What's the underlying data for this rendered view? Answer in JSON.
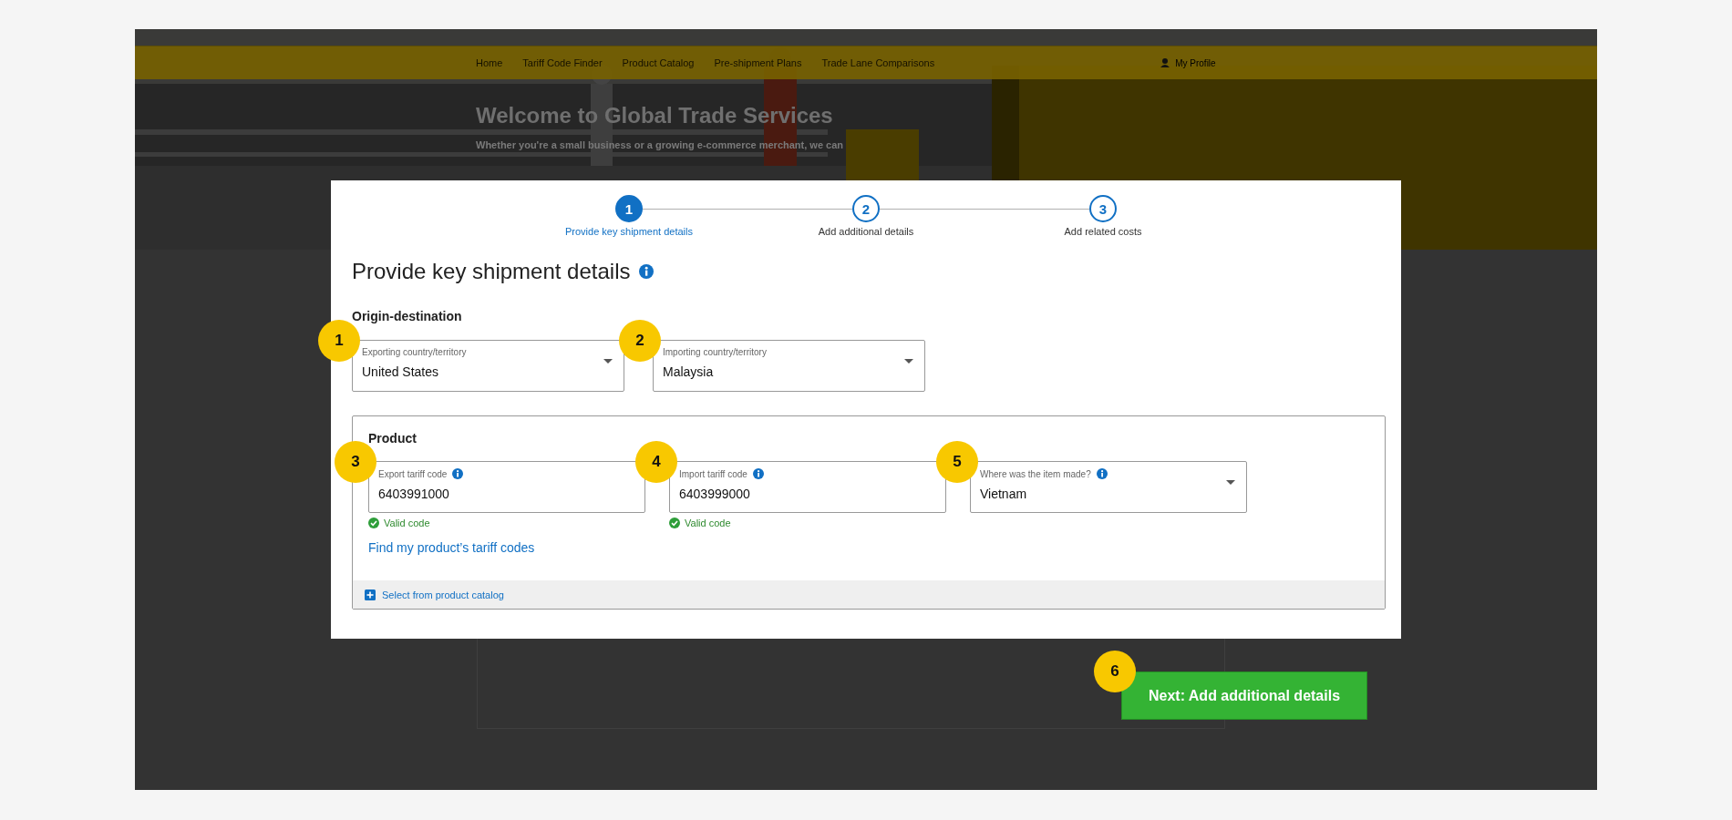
{
  "nav": {
    "items": [
      {
        "label": "Home"
      },
      {
        "label": "Tariff Code Finder"
      },
      {
        "label": "Product Catalog"
      },
      {
        "label": "Pre-shipment Plans"
      },
      {
        "label": "Trade Lane Comparisons"
      }
    ],
    "profile": "My Profile"
  },
  "hero": {
    "title": "Welcome to Global Trade Services",
    "subtitle": "Whether you're a small business or a growing e-commerce merchant, we can"
  },
  "dialog": {
    "steps": [
      {
        "number": "1",
        "label": "Provide key shipment details",
        "selected": true
      },
      {
        "number": "2",
        "label": "Add additional details",
        "selected": false
      },
      {
        "number": "3",
        "label": "Add related costs",
        "selected": false
      }
    ],
    "title": "Provide key shipment details",
    "origin": {
      "heading": "Origin-destination",
      "fields": [
        {
          "kind": "dropdown",
          "label": "Exporting country/territory",
          "value": "United States",
          "badge": "1"
        },
        {
          "kind": "dropdown",
          "label": "Importing country/territory",
          "value": "Malaysia",
          "badge": "2"
        }
      ]
    },
    "product": {
      "heading": "Product",
      "fields": [
        {
          "kind": "text",
          "label": "Export tariff code",
          "value": "6403991000",
          "validation": "Valid code",
          "badge": "3"
        },
        {
          "kind": "text",
          "label": "Import tariff code",
          "value": "6403999000",
          "validation": "Valid code",
          "badge": "4"
        },
        {
          "kind": "dropdown",
          "label": "Where was the item made?",
          "value": "Vietnam",
          "badge": "5"
        }
      ],
      "link": "Find my product’s tariff codes",
      "catalog": "Select from product catalog"
    }
  },
  "next_button": {
    "label": "Next: Add additional details",
    "badge": "6"
  }
}
